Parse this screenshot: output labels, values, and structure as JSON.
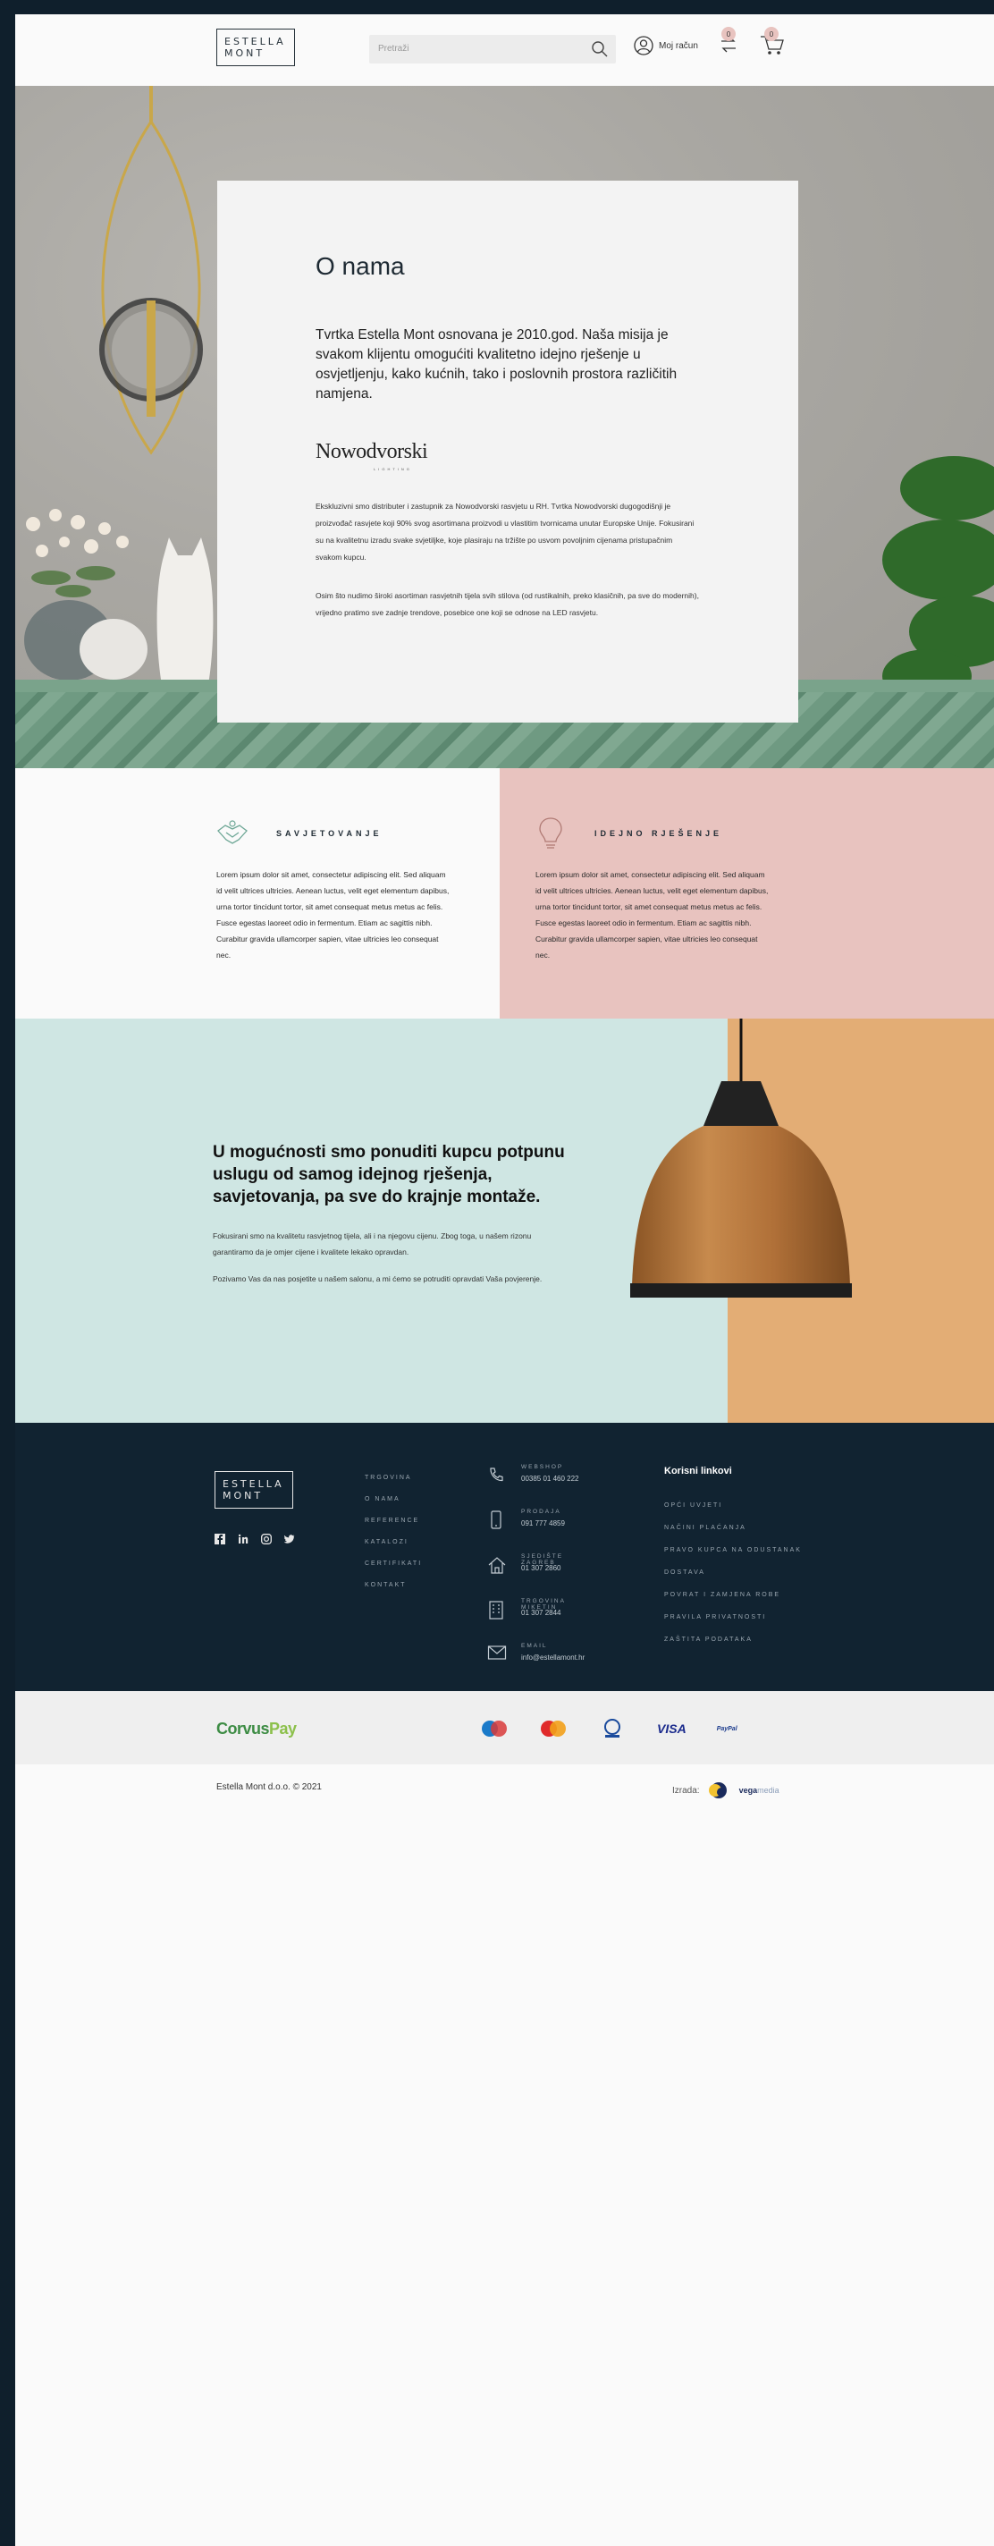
{
  "header": {
    "logo_line1": "ESTELLA",
    "logo_line2": "MONT",
    "search_placeholder": "Pretraži",
    "account_label": "Moj račun",
    "compare_count": "0",
    "cart_count": "0"
  },
  "about": {
    "title": "O nama",
    "lead": "Tvrtka Estella Mont osnovana je 2010.god. Naša misija je svakom klijentu omogućiti kvalitetno idejno rješenje u osvjetljenju, kako kućnih, tako i poslovnih prostora različitih namjena.",
    "brand_name": "Nowodvorski",
    "brand_sub": "LIGHTING",
    "paragraph1": "Ekskluzivni smo distributer i zastupnik za Nowodvorski rasvjetu u RH. Tvrtka Nowodvorski dugogodišnji je proizvođač rasvjete koji 90% svog asortimana proizvodi u vlastitim tvornicama unutar Europske Unije. Fokusirani su na kvalitetnu izradu svake svjetiljke, koje plasiraju na tržište po usvom povoljnim cijenama pristupačnim svakom kupcu.",
    "paragraph2": "Osim što nudimo široki asortiman rasvjetnih tijela svih stilova (od rustikalnih, preko klasičnih, pa sve do modernih), vrijedno pratimo sve zadnje trendove, posebice one koji se odnose na LED rasvjetu."
  },
  "services": [
    {
      "title": "SAVJETOVANJE",
      "icon": "handshake-icon",
      "text": "Lorem ipsum dolor sit amet, consectetur adipiscing elit. Sed aliquam id velit ultrices ultricies. Aenean luctus, velit eget elementum dapibus, urna tortor tincidunt tortor, sit amet consequat metus metus ac felis. Fusce egestas laoreet odio in fermentum. Etiam ac sagittis nibh. Curabitur gravida ullamcorper sapien, vitae ultricies leo consequat nec."
    },
    {
      "title": "IDEJNO RJEŠENJE",
      "icon": "lightbulb-icon",
      "text": "Lorem ipsum dolor sit amet, consectetur adipiscing elit. Sed aliquam id velit ultrices ultricies. Aenean luctus, velit eget elementum dapibus, urna tortor tincidunt tortor, sit amet consequat metus metus ac felis. Fusce egestas laoreet odio in fermentum. Etiam ac sagittis nibh. Curabitur gravida ullamcorper sapien, vitae ultricies leo consequat nec."
    }
  ],
  "promo": {
    "heading": "U mogućnosti smo ponuditi kupcu potpunu uslugu od samog idejnog rješenja, savjetovanja, pa sve do krajnje montaže.",
    "text1": "Fokusirani smo na kvalitetu rasvjetnog tijela, ali i na njegovu cijenu. Zbog toga, u našem rizonu garantiramo da je omjer cijene i kvalitete lekako opravdan.",
    "text2": "Pozivamo Vas da nas posjetite u našem salonu, a mi ćemo se potruditi opravdati Vaša povjerenje."
  },
  "footer": {
    "logo_line1": "ESTELLA",
    "logo_line2": "MONT",
    "nav": [
      "TRGOVINA",
      "O NAMA",
      "REFERENCE",
      "KATALOZI",
      "CERTIFIKATI",
      "KONTAKT"
    ],
    "contacts": [
      {
        "icon": "phone-icon",
        "label": "WEBSHOP",
        "value": "00385 01 460 222"
      },
      {
        "icon": "mobile-icon",
        "label": "PRODAJA",
        "value": "091 777 4859"
      },
      {
        "icon": "home-icon",
        "label": "SJEDIŠTE ZAGREB",
        "value": "01 307 2860"
      },
      {
        "icon": "building-icon",
        "label": "TRGOVINA MIKETIN",
        "value": "01 307 2844"
      },
      {
        "icon": "mail-icon",
        "label": "EMAIL",
        "value": "info@estellamont.hr"
      }
    ],
    "links_title": "Korisni linkovi",
    "links": [
      "OPĆI UVJETI",
      "NAČINI PLAĆANJA",
      "PRAVO KUPCA NA ODUSTANAK",
      "DOSTAVA",
      "POVRAT I ZAMJENA ROBE",
      "PRAVILA PRIVATNOSTI",
      "ZAŠTITA PODATAKA"
    ]
  },
  "payment": {
    "provider": "Corvus",
    "provider_suffix": "Pay",
    "visa": "VISA",
    "paypal": "PayPal"
  },
  "bottom": {
    "copyright": "Estella Mont d.o.o. © 2021",
    "made_by": "Izrada:",
    "agency": "vega",
    "agency_suffix": "media"
  }
}
